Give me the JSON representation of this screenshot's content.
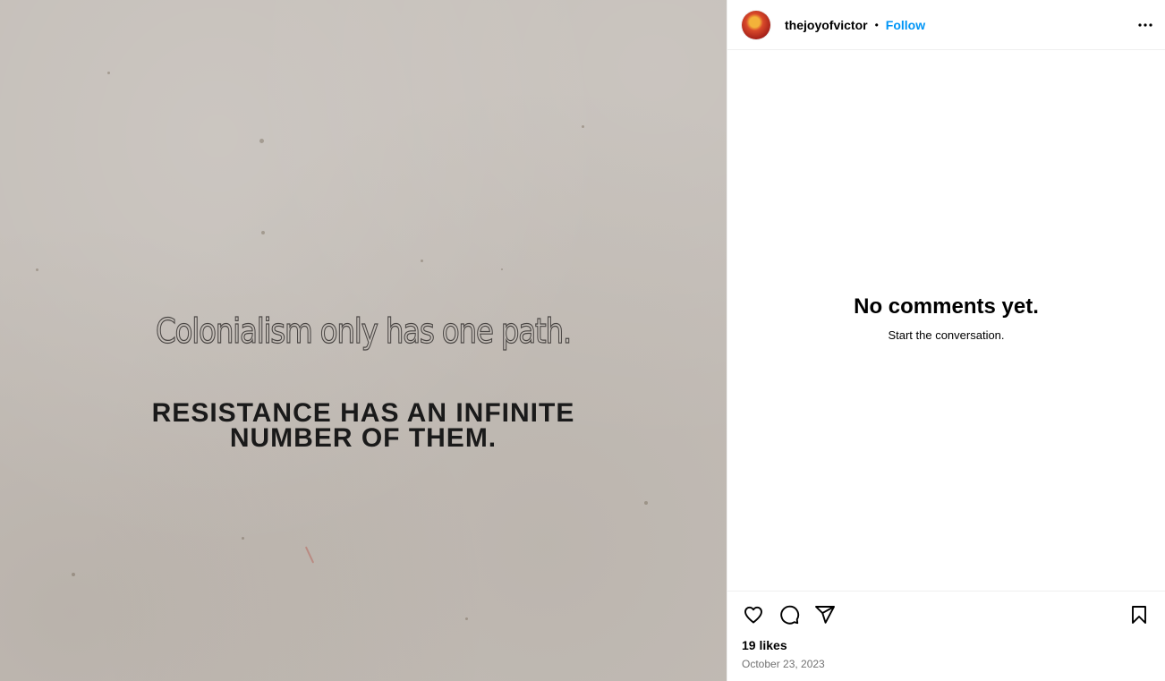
{
  "media": {
    "line1": "Colonialism only has one path.",
    "line2_a": "RESISTANCE HAS AN INFINITE",
    "line2_b": "NUMBER OF THEM."
  },
  "header": {
    "username": "thejoyofvictor",
    "separator": "•",
    "follow_label": "Follow",
    "more_icon": "more-horizontal-icon"
  },
  "comments": {
    "empty_title": "No comments yet.",
    "empty_subtitle": "Start the conversation."
  },
  "footer": {
    "likes": "19 likes",
    "date": "October 23, 2023",
    "icons": [
      "heart-icon",
      "comment-icon",
      "share-icon",
      "bookmark-icon"
    ]
  },
  "colors": {
    "accent": "#0095f6",
    "muted": "#737373",
    "divider": "#efefef"
  }
}
